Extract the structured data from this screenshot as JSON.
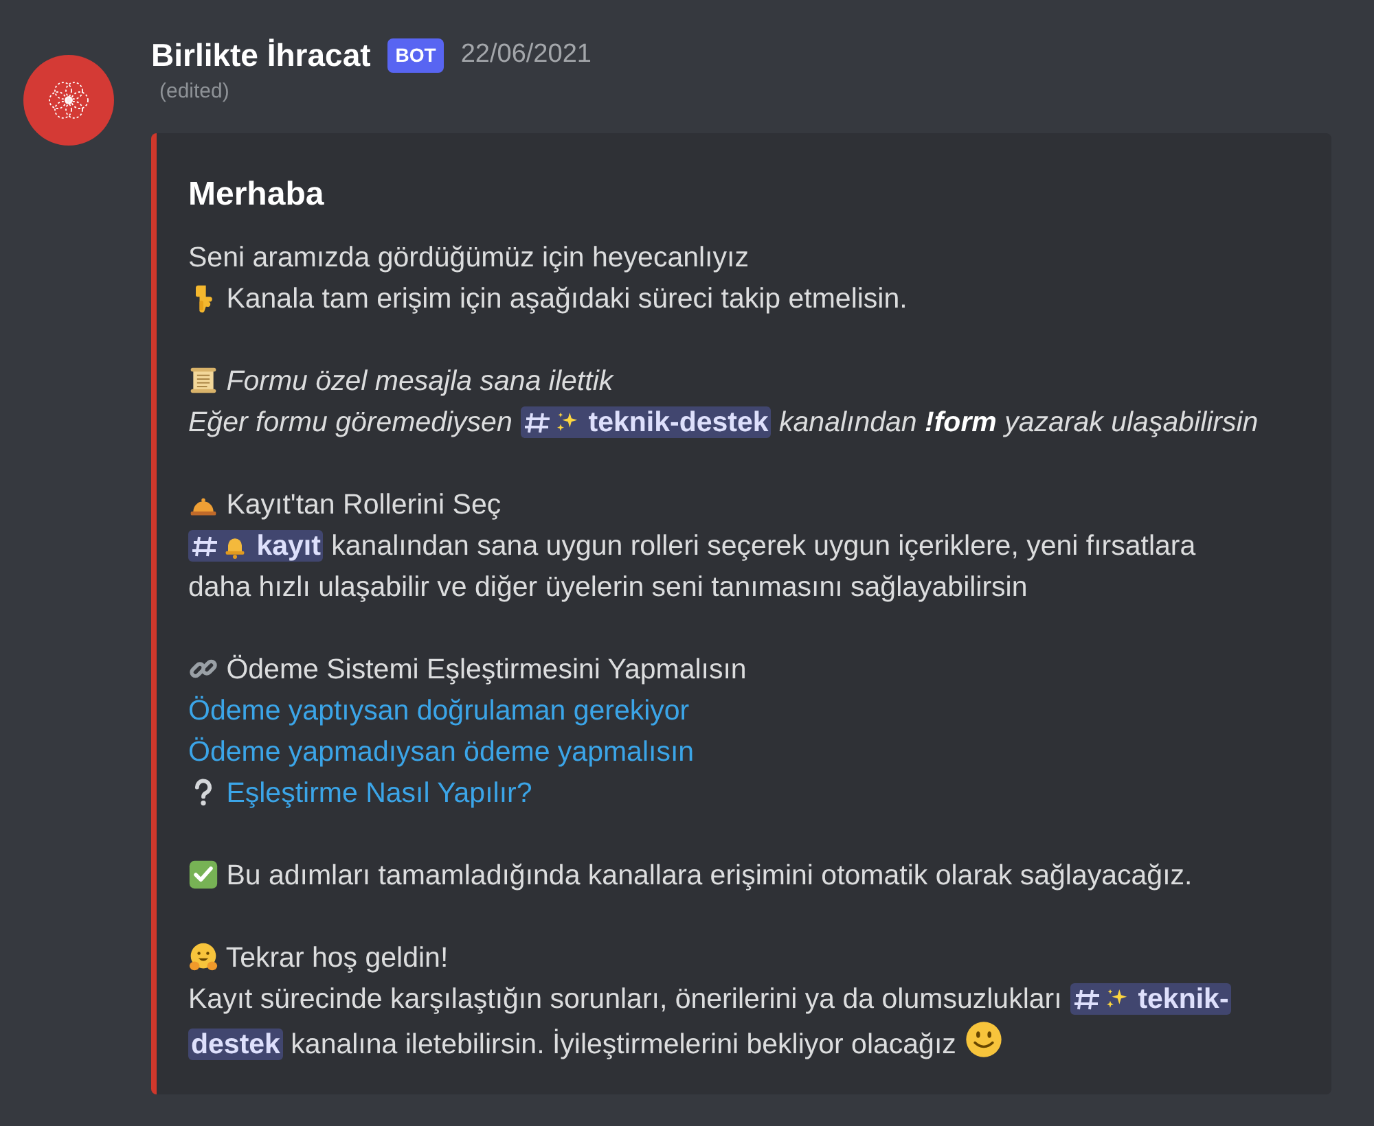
{
  "message": {
    "author": "Birlikte İhracat",
    "badge": "BOT",
    "timestamp": "22/06/2021",
    "edited": "(edited)"
  },
  "embed": {
    "title": "Merhaba",
    "paragraphs": [
      [
        {
          "segments": [
            {
              "kind": "text",
              "text": "Seni aramızda gördüğümüz için heyecanlıyız"
            }
          ]
        },
        {
          "segments": [
            {
              "kind": "icon"
            },
            {
              "kind": "text",
              "text": "Kanala tam erişim için aşağıdaki süreci takip etmelisin."
            }
          ]
        }
      ],
      [
        {
          "segments": [
            {
              "kind": "icon"
            },
            {
              "kind": "italic",
              "text": "Formu özel mesajla sana ilettik"
            }
          ]
        },
        {
          "segments": [
            {
              "kind": "italic",
              "text": "Eğer formu göremediysen"
            },
            {
              "kind": "mention",
              "text": "teknik-destek"
            },
            {
              "kind": "italic",
              "text": "kanalından"
            },
            {
              "kind": "bold-italic",
              "text": "!form"
            },
            {
              "kind": "italic",
              "text": "yazarak ulaşabilirsin"
            }
          ]
        }
      ],
      [
        {
          "segments": [
            {
              "kind": "icon"
            },
            {
              "kind": "text",
              "text": "Kayıt'tan Rollerini Seç"
            }
          ]
        },
        {
          "segments": [
            {
              "kind": "mention",
              "text": "kayıt"
            },
            {
              "kind": "text",
              "text": "kanalından sana uygun rolleri seçerek uygun içeriklere, yeni fırsatlara"
            }
          ]
        },
        {
          "segments": [
            {
              "kind": "text",
              "text": "daha hızlı ulaşabilir ve diğer üyelerin seni tanımasını sağlayabilirsin"
            }
          ]
        }
      ],
      [
        {
          "segments": [
            {
              "kind": "icon"
            },
            {
              "kind": "text",
              "text": "Ödeme Sistemi Eşleştirmesini Yapmalısın"
            }
          ]
        },
        {
          "segments": [
            {
              "kind": "link",
              "text": "Ödeme yaptıysan doğrulaman gerekiyor"
            }
          ]
        },
        {
          "segments": [
            {
              "kind": "link",
              "text": "Ödeme yapmadıysan ödeme yapmalısın"
            }
          ]
        },
        {
          "segments": [
            {
              "kind": "icon"
            },
            {
              "kind": "link",
              "text": "Eşleştirme Nasıl Yapılır?"
            }
          ]
        }
      ],
      [
        {
          "segments": [
            {
              "kind": "icon"
            },
            {
              "kind": "text",
              "text": "Bu adımları tamamladığında kanallara erişimini otomatik olarak sağlayacağız."
            }
          ]
        }
      ],
      [
        {
          "segments": [
            {
              "kind": "icon"
            },
            {
              "kind": "text",
              "text": "Tekrar hoş geldin!"
            }
          ]
        },
        {
          "segments": [
            {
              "kind": "text",
              "text": "Kayıt sürecinde karşılaştığın sorunları, önerilerini ya da olumsuzlukları"
            },
            {
              "kind": "mention",
              "text": "teknik-"
            }
          ]
        },
        {
          "segments": [
            {
              "kind": "mention-cont",
              "text": "destek"
            },
            {
              "kind": "text",
              "text": "kanalına iletebilirsin. İyileştirmelerini bekliyor olacağız"
            },
            {
              "kind": "icon"
            }
          ]
        }
      ]
    ]
  }
}
